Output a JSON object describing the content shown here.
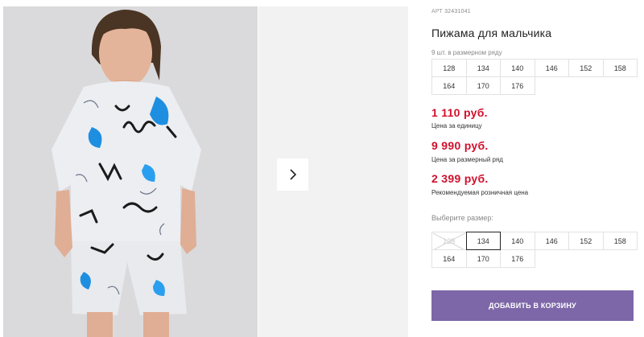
{
  "product": {
    "sku_label": "АРТ",
    "sku": "32431041",
    "title": "Пижама для мальчика",
    "range_note": "9 шт. в размерном ряду",
    "range_sizes": [
      "128",
      "134",
      "140",
      "146",
      "152",
      "158",
      "164",
      "170",
      "176"
    ]
  },
  "prices": [
    {
      "value": "1 110 руб.",
      "caption": "Цена за единицу"
    },
    {
      "value": "9 990 руб.",
      "caption": "Цена за размерный ряд"
    },
    {
      "value": "2 399 руб.",
      "caption": "Рекомендуемая розничная цена"
    }
  ],
  "size_selector": {
    "label": "Выберите размер:",
    "sizes": [
      "128",
      "134",
      "140",
      "146",
      "152",
      "158",
      "164",
      "170",
      "176"
    ],
    "selected": "134",
    "unavailable": [
      "128"
    ]
  },
  "cart_button": "Добавить в корзину",
  "colors": {
    "price": "#d0102c",
    "button": "#7d67a8"
  },
  "icons": {
    "next": "chevron-right-icon"
  }
}
